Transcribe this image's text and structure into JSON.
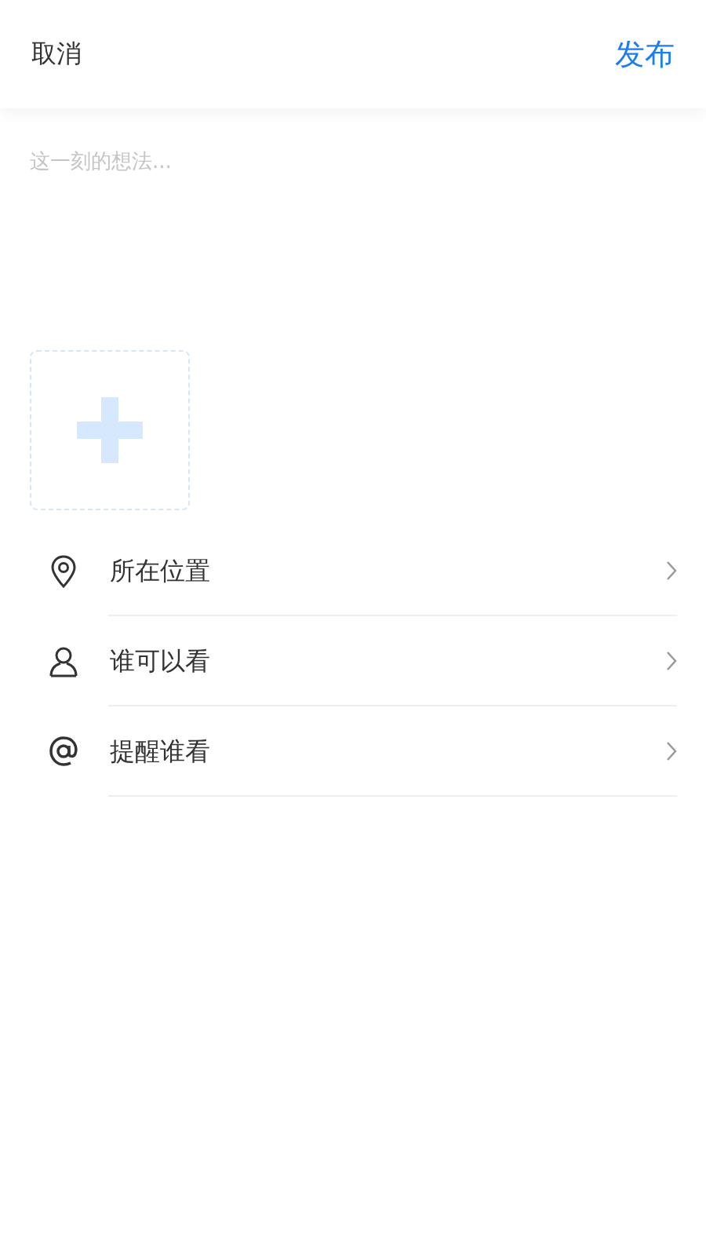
{
  "header": {
    "cancel": "取消",
    "publish": "发布"
  },
  "post": {
    "placeholder": "这一刻的想法..."
  },
  "options": [
    {
      "kind": "location",
      "label": "所在位置"
    },
    {
      "kind": "audience",
      "label": "谁可以看"
    },
    {
      "kind": "mention",
      "label": "提醒谁看"
    }
  ]
}
